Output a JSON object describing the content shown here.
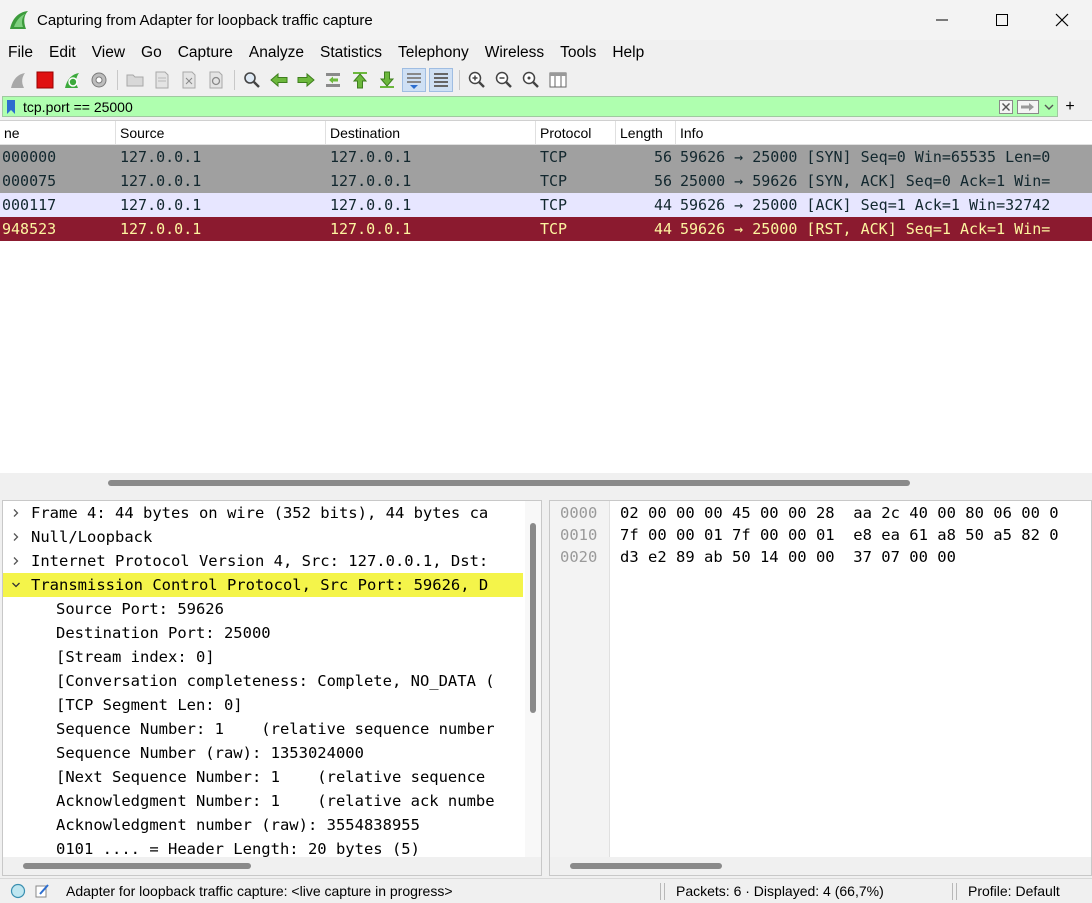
{
  "window": {
    "title": "Capturing from Adapter for loopback traffic capture",
    "minimize": "—",
    "maximize": "☐",
    "close": "✕"
  },
  "menu": [
    "File",
    "Edit",
    "View",
    "Go",
    "Capture",
    "Analyze",
    "Statistics",
    "Telephony",
    "Wireless",
    "Tools",
    "Help"
  ],
  "filter": {
    "value": "tcp.port == 25000",
    "add": "+"
  },
  "packet_list": {
    "columns": [
      "ne",
      "Source",
      "Destination",
      "Protocol",
      "Length",
      "Info"
    ],
    "rows": [
      {
        "time": "000000",
        "source": "127.0.0.1",
        "destination": "127.0.0.1",
        "protocol": "TCP",
        "length": "56",
        "info": "59626 → 25000 [SYN] Seq=0 Win=65535 Len=0",
        "bg": "#a0a0a0",
        "fg": "#12272e"
      },
      {
        "time": "000075",
        "source": "127.0.0.1",
        "destination": "127.0.0.1",
        "protocol": "TCP",
        "length": "56",
        "info": "25000 → 59626 [SYN, ACK] Seq=0 Ack=1 Win=",
        "bg": "#a0a0a0",
        "fg": "#12272e"
      },
      {
        "time": "000117",
        "source": "127.0.0.1",
        "destination": "127.0.0.1",
        "protocol": "TCP",
        "length": "44",
        "info": "59626 → 25000 [ACK] Seq=1 Ack=1 Win=32742",
        "bg": "#e7e6ff",
        "fg": "#12272e"
      },
      {
        "time": "948523",
        "source": "127.0.0.1",
        "destination": "127.0.0.1",
        "protocol": "TCP",
        "length": "44",
        "info": "59626 → 25000 [RST, ACK] Seq=1 Ack=1 Win=",
        "bg": "#8b1a2f",
        "fg": "#fdf5a0"
      }
    ]
  },
  "details": {
    "rows": [
      {
        "arrow": "›",
        "text": "Frame 4: 44 bytes on wire (352 bits), 44 bytes ca",
        "highlight": false
      },
      {
        "arrow": "›",
        "text": "Null/Loopback",
        "highlight": false
      },
      {
        "arrow": "›",
        "text": "Internet Protocol Version 4, Src: 127.0.0.1, Dst:",
        "highlight": false
      },
      {
        "arrow": "⌄",
        "text": "Transmission Control Protocol, Src Port: 59626, D",
        "highlight": true
      },
      {
        "arrow": "",
        "text": "Source Port: 59626",
        "highlight": false
      },
      {
        "arrow": "",
        "text": "Destination Port: 25000",
        "highlight": false
      },
      {
        "arrow": "",
        "text": "[Stream index: 0]",
        "highlight": false
      },
      {
        "arrow": "",
        "text": "[Conversation completeness: Complete, NO_DATA (",
        "highlight": false
      },
      {
        "arrow": "",
        "text": "[TCP Segment Len: 0]",
        "highlight": false
      },
      {
        "arrow": "",
        "text": "Sequence Number: 1    (relative sequence number",
        "highlight": false
      },
      {
        "arrow": "",
        "text": "Sequence Number (raw): 1353024000",
        "highlight": false
      },
      {
        "arrow": "",
        "text": "[Next Sequence Number: 1    (relative sequence ",
        "highlight": false
      },
      {
        "arrow": "",
        "text": "Acknowledgment Number: 1    (relative ack numbe",
        "highlight": false
      },
      {
        "arrow": "",
        "text": "Acknowledgment number (raw): 3554838955",
        "highlight": false
      },
      {
        "arrow": "",
        "text": "0101 .... = Header Length: 20 bytes (5)",
        "highlight": false
      }
    ]
  },
  "bytes": {
    "rows": [
      {
        "offset": "0000",
        "hex": "02 00 00 00 45 00 00 28  aa 2c 40 00 80 06 00 0"
      },
      {
        "offset": "0010",
        "hex": "7f 00 00 01 7f 00 00 01  e8 ea 61 a8 50 a5 82 0"
      },
      {
        "offset": "0020",
        "hex": "d3 e2 89 ab 50 14 00 00  37 07 00 00"
      }
    ]
  },
  "status": {
    "capture_text": "Adapter for loopback traffic capture: <live capture in progress>",
    "packets_text": "Packets: 6 · Displayed: 4 (66,7%)",
    "profile_text": "Profile: Default"
  },
  "colors": {
    "filter_bg": "#afffaf",
    "highlight": "#f4f44a",
    "rst_row": "#8b1a2f",
    "syn_row": "#a0a0a0"
  }
}
